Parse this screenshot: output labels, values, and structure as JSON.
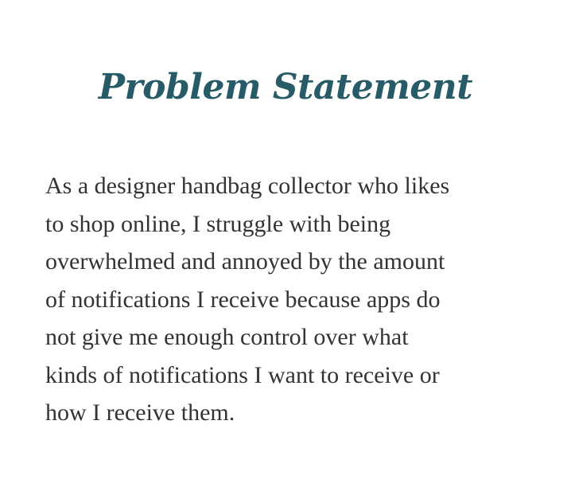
{
  "title": "Problem Statement",
  "colors": {
    "title": "#275b67",
    "body": "#333333"
  },
  "statement_lines": [
    "As a designer handbag collector who likes",
    "to shop online, I struggle with being",
    "overwhelmed and annoyed by the amount",
    "of notifications I receive because apps do",
    "not give me enough control over what",
    "kinds of notifications I want to receive or",
    "how I receive them."
  ]
}
